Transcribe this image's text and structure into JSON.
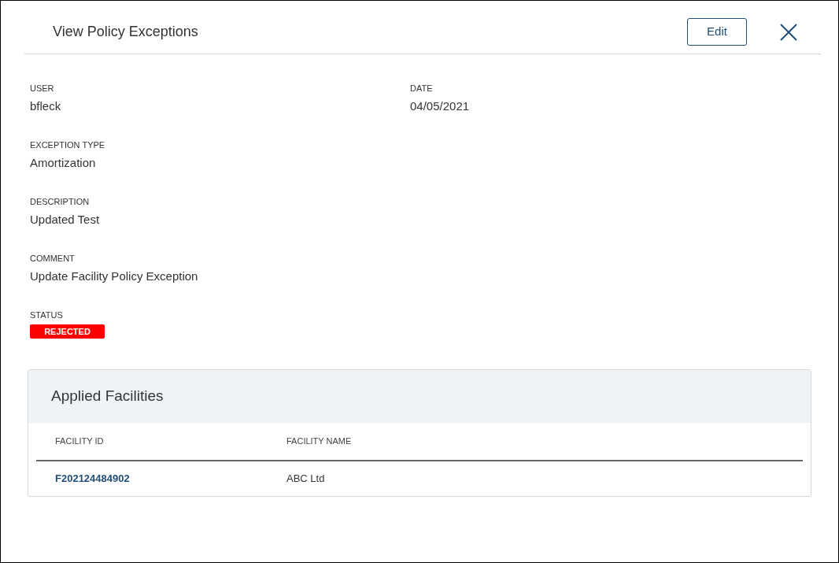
{
  "dialog": {
    "title": "View Policy Exceptions",
    "edit_button": "Edit"
  },
  "fields": [
    {
      "label": "USER",
      "value": "bfleck"
    },
    {
      "label": "DATE",
      "value": "04/05/2021"
    },
    {
      "label": "EXCEPTION TYPE",
      "value": "Amortization"
    },
    {
      "label": "DESCRIPTION",
      "value": "Updated Test"
    },
    {
      "label": "COMMENT",
      "value": "Update Facility Policy Exception"
    }
  ],
  "status": {
    "label": "STATUS",
    "value": "REJECTED",
    "kind": "rejected"
  },
  "applied_facilities": {
    "title": "Applied Facilities",
    "columns": [
      "FACILITY ID",
      "FACILITY NAME"
    ],
    "rows": [
      {
        "facility_id": "F202124484902",
        "facility_name": "ABC Ltd"
      }
    ]
  }
}
